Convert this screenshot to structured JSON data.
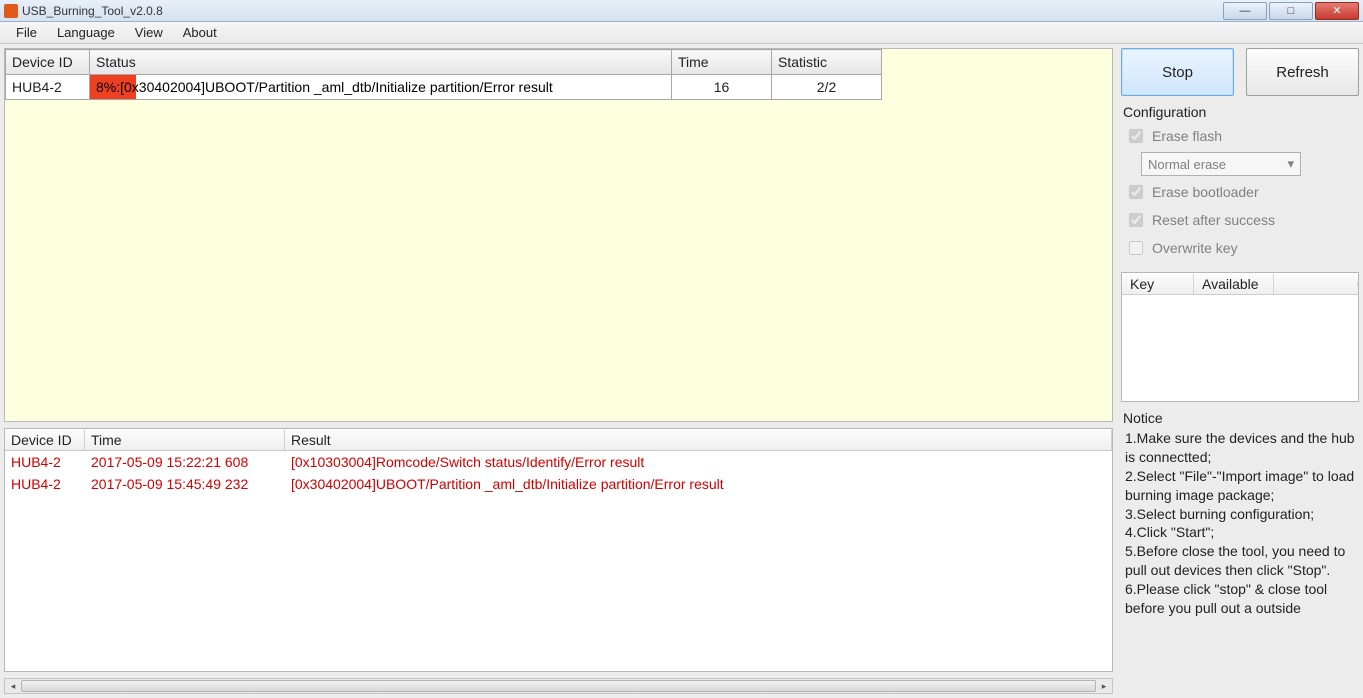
{
  "window": {
    "title": "USB_Burning_Tool_v2.0.8"
  },
  "menu": {
    "file": "File",
    "language": "Language",
    "view": "View",
    "about": "About"
  },
  "statusTable": {
    "headers": {
      "device": "Device ID",
      "status": "Status",
      "time": "Time",
      "statistic": "Statistic"
    },
    "rows": [
      {
        "device": "HUB4-2",
        "statusPct": "8%",
        "statusText": "8%:[0x30402004]UBOOT/Partition _aml_dtb/Initialize partition/Error result",
        "time": "16",
        "statistic": "2/2"
      }
    ]
  },
  "logTable": {
    "headers": {
      "device": "Device ID",
      "time": "Time",
      "result": "Result"
    },
    "rows": [
      {
        "device": "HUB4-2",
        "time": "2017-05-09 15:22:21 608",
        "result": "[0x10303004]Romcode/Switch status/Identify/Error result"
      },
      {
        "device": "HUB4-2",
        "time": "2017-05-09 15:45:49 232",
        "result": "[0x30402004]UBOOT/Partition _aml_dtb/Initialize partition/Error result"
      }
    ]
  },
  "buttons": {
    "stop": "Stop",
    "refresh": "Refresh"
  },
  "config": {
    "title": "Configuration",
    "eraseFlash": "Erase flash",
    "eraseMode": "Normal erase",
    "eraseBootloader": "Erase bootloader",
    "resetAfter": "Reset after success",
    "overwriteKey": "Overwrite key"
  },
  "keyTable": {
    "key": "Key",
    "available": "Available"
  },
  "notice": {
    "title": "Notice",
    "line1": "1.Make sure the devices and the hub is connectted;",
    "line2": "2.Select \"File\"-\"Import image\" to load burning image package;",
    "line3": "3.Select burning configuration;",
    "line4": "4.Click \"Start\";",
    "line5": "5.Before close the tool, you need to pull out devices then click \"Stop\".",
    "line6": "6.Please click \"stop\" & close tool before you pull out a outside"
  }
}
